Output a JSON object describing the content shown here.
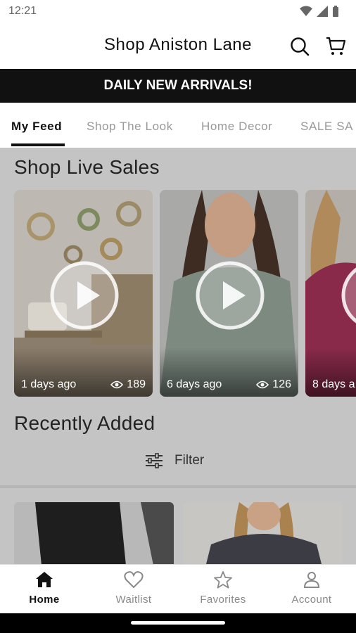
{
  "status_bar": {
    "time": "12:21"
  },
  "header": {
    "title": "Shop Aniston Lane"
  },
  "banner": {
    "text": "DAILY NEW ARRIVALS!"
  },
  "tabs": [
    {
      "label": "My Feed",
      "active": true
    },
    {
      "label": "Shop The Look",
      "active": false
    },
    {
      "label": "Home Decor",
      "active": false
    },
    {
      "label": "SALE SA",
      "active": false
    }
  ],
  "live_sales": {
    "title": "Shop Live Sales",
    "cards": [
      {
        "age": "1 days ago",
        "views": "189"
      },
      {
        "age": "6 days ago",
        "views": "126"
      },
      {
        "age": "8 days a",
        "views": ""
      }
    ]
  },
  "recently_added": {
    "title": "Recently Added",
    "filter_label": "Filter"
  },
  "bottom_nav": [
    {
      "label": "Home",
      "icon": "home-icon",
      "active": true
    },
    {
      "label": "Waitlist",
      "icon": "heart-icon",
      "active": false
    },
    {
      "label": "Favorites",
      "icon": "star-icon",
      "active": false
    },
    {
      "label": "Account",
      "icon": "person-icon",
      "active": false
    }
  ],
  "colors": {
    "banner_bg": "#111111",
    "overlay": "#c4c4c4",
    "text_active": "#111111",
    "text_inactive": "#999999"
  }
}
